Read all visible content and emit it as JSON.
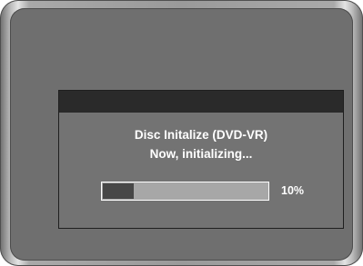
{
  "dialog": {
    "title": "Disc Initalize (DVD-VR)",
    "message": "Now, initializing...",
    "progress": {
      "fraction": 0.19,
      "label": "10%"
    }
  },
  "colors": {
    "screen": "#6f6f6f",
    "dialog_body": "#737373",
    "dialog_titlebar": "#2a2a2a",
    "progress_track": "#a7a7a7",
    "progress_fill": "#474747",
    "text": "#ffffff"
  }
}
